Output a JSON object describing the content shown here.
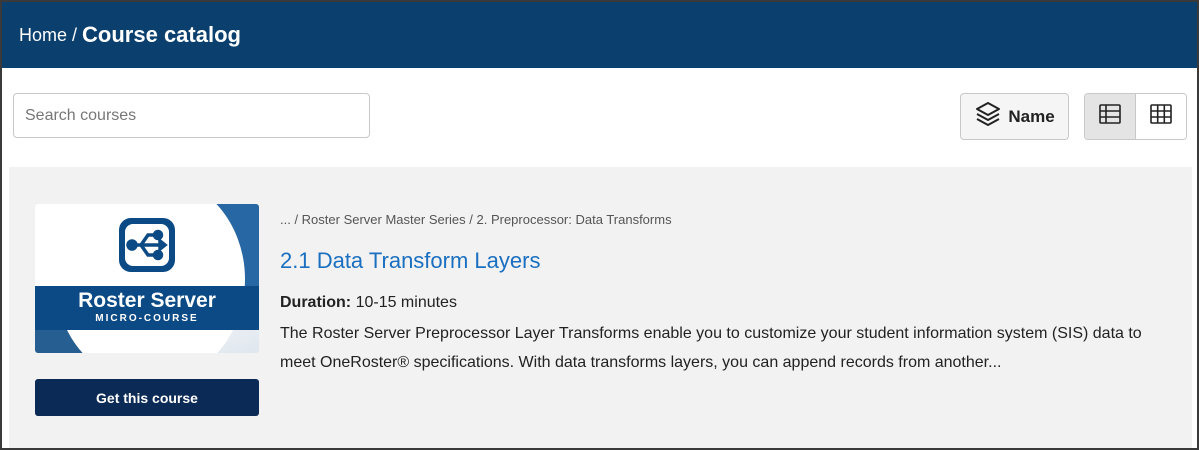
{
  "header": {
    "breadcrumb_home": "Home",
    "breadcrumb_separator": "/",
    "title": "Course catalog"
  },
  "toolbar": {
    "search_placeholder": "Search courses",
    "sort_label": "Name",
    "sort_icon": "layers-icon",
    "view_list_icon": "list-view-icon",
    "view_grid_icon": "grid-view-icon",
    "active_view": "list"
  },
  "courses": [
    {
      "breadcrumb": "... / Roster Server Master Series / 2. Preprocessor: Data Transforms",
      "title": "2.1 Data Transform Layers",
      "duration_label": "Duration:",
      "duration_value": "10-15 minutes",
      "description": "The Roster Server Preprocessor Layer Transforms enable you to customize your student information system (SIS) data to meet OneRoster® specifications. With data transforms layers, you can append records from another...",
      "thumbnail": {
        "title": "Roster Server",
        "subtitle": "MICRO-COURSE",
        "icon": "share-nodes-icon"
      },
      "action_label": "Get this course"
    }
  ],
  "colors": {
    "header_bg": "#0b3f6e",
    "link": "#1a6fc0",
    "button_bg": "#0b2a55",
    "results_bg": "#f2f2f2"
  }
}
